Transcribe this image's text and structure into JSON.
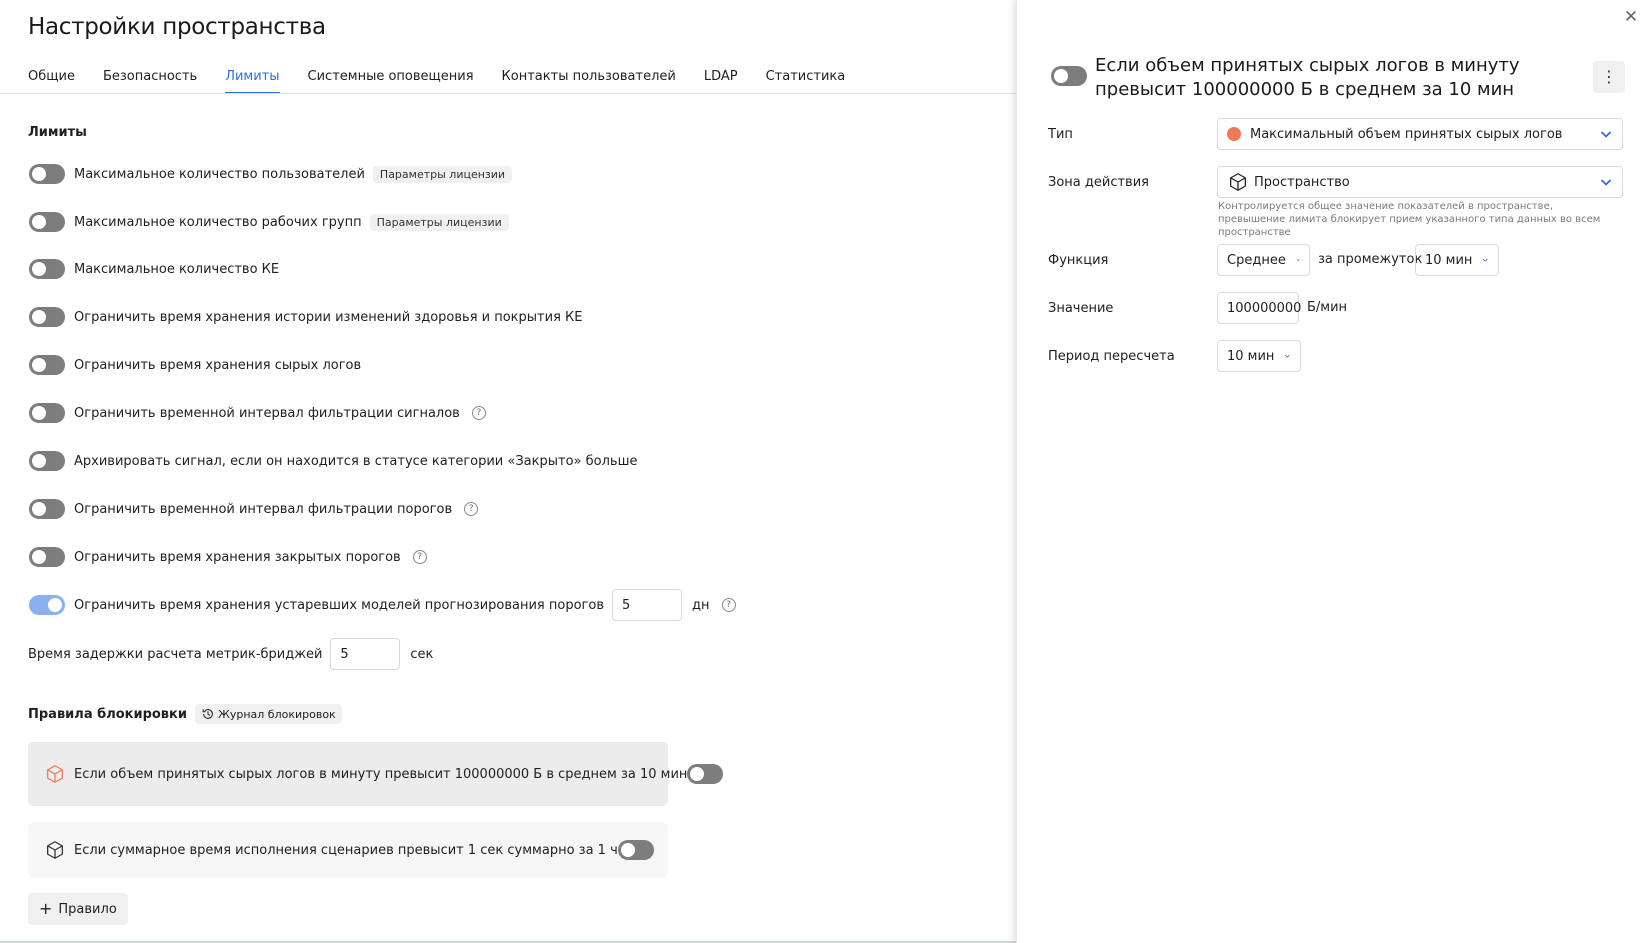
{
  "page": {
    "title": "Настройки пространства",
    "tabs": [
      {
        "label": "Общие"
      },
      {
        "label": "Безопасность"
      },
      {
        "label": "Лимиты",
        "active": true
      },
      {
        "label": "Системные оповещения"
      },
      {
        "label": "Контакты пользователей"
      },
      {
        "label": "LDAP"
      },
      {
        "label": "Статистика"
      }
    ]
  },
  "limits": {
    "section_title": "Лимиты",
    "items": [
      {
        "label": "Максимальное количество пользователей",
        "tag": "Параметры лицензии",
        "enabled": false
      },
      {
        "label": "Максимальное количество рабочих групп",
        "tag": "Параметры лицензии",
        "enabled": false
      },
      {
        "label": "Максимальное количество КЕ",
        "enabled": false
      },
      {
        "label": "Ограничить время хранения истории изменений здоровья и покрытия КЕ",
        "enabled": false
      },
      {
        "label": "Ограничить время хранения сырых логов",
        "enabled": false
      },
      {
        "label": "Ограничить временной интервал фильтрации сигналов",
        "help": true,
        "enabled": false
      },
      {
        "label": "Архивировать сигнал, если он находится в статусе категории «Закрыто» больше",
        "enabled": false
      },
      {
        "label": "Ограничить временной интервал фильтрации порогов",
        "help": true,
        "enabled": false
      },
      {
        "label": "Ограничить время хранения закрытых порогов",
        "help": true,
        "enabled": false
      },
      {
        "label": "Ограничить время хранения устаревших моделей прогнозирования порогов",
        "value": "5",
        "unit": "дн",
        "help": true,
        "enabled": true
      }
    ],
    "delay": {
      "label": "Время задержки расчета метрик-бриджей",
      "value": "5",
      "unit": "сек"
    }
  },
  "rules": {
    "title": "Правила блокировки",
    "journal_label": "Журнал блокировок",
    "items": [
      {
        "text": "Если объем принятых сырых логов в минуту превысит 100000000 Б в среднем за 10 мин",
        "enabled": false,
        "selected": true,
        "icon_color": "#f0795a"
      },
      {
        "text": "Если суммарное время исполнения сценариев превысит 1 сек суммарно за 1 ч",
        "enabled": false,
        "selected": false,
        "icon_color": "#333333"
      }
    ],
    "add_label": "Правило"
  },
  "panel": {
    "title": "Если объем принятых сырых логов в минуту превысит 100000000 Б в среднем за 10 мин",
    "enabled": false,
    "type": {
      "label": "Тип",
      "value": "Максимальный объем принятых сырых логов",
      "dot_color": "#f0795a"
    },
    "zone": {
      "label": "Зона действия",
      "value": "Пространство",
      "hint": "Контролируется общее значение показателей в пространстве, превышение лимита блокирует прием указанного типа данных во всем пространстве"
    },
    "function": {
      "label": "Функция",
      "value": "Среднее",
      "interval_label": "за промежуток",
      "interval_value": "10 мин"
    },
    "value": {
      "label": "Значение",
      "value": "100000000",
      "unit": "Б/мин"
    },
    "period": {
      "label": "Период пересчета",
      "value": "10 мин"
    }
  },
  "colors": {
    "accent": "#2f6fd6",
    "toggle_on": "#8ab0f0",
    "toggle_off": "#7d7d7d"
  }
}
